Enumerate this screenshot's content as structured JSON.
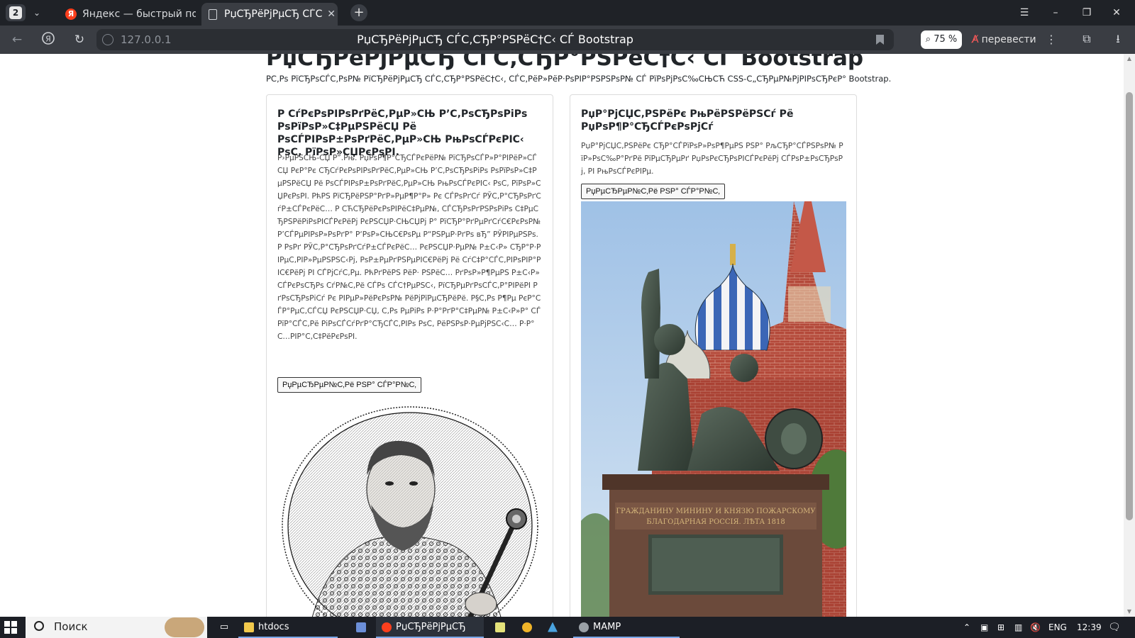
{
  "browser": {
    "tab_count": "2",
    "tabs": [
      {
        "title": "Яндекс — быстрый поиск",
        "favicon": "yandex-icon"
      },
      {
        "title": "РџСЂРёРјРµСЂ СЃС‚СЂР°РЅРёС†С‹ СЃ Bootstrap",
        "favicon": "document-icon",
        "close": "✕"
      }
    ],
    "new_tab": "+",
    "address": "127.0.0.1",
    "page_title": "РџСЂРёРјРµСЂ СЃС‚СЂР°РЅРёС†С‹ СЃ Bootstrap",
    "zoom": "75 %",
    "translate_label": "перевести"
  },
  "page": {
    "title": "РџСЂРёРјРµСЂ СЃС‚СЂР°РЅРёС†С‹ СЃ Bootstrap",
    "lead": "РС‚Рѕ РїСЂРѕСЃС‚РѕР№ РїСЂРёРјРµСЂ СЃС‚СЂР°РЅРёС†С‹, СЃС‚РёР»РёР·РѕРІР°РЅРЅРѕР№ СЃ РїРѕРјРѕС‰СЊСЋ CSS-С„СЂРµР№РјРІРѕСЂРєР° Bootstrap.",
    "cards": [
      {
        "title": "Р СѓРєРѕРІРѕРґРёС‚РµР»СЊ Р’С‚РѕСЂРѕРіРѕ РѕРїРѕР»С‡РµРЅРёСЏ Рё РѕСЃРІРѕР±РѕРґРёС‚РµР»СЊ РњРѕСЃРєРІС‹ РѕС‚ РїРѕР»СЏРєРѕРІ.",
        "text": "Р›РµРЅСЊ-СЏ Р”.Рњ. РџРѕР¶Р°СЂСЃРєРёР№ РїСЂРѕСЃР»Р°РІРёР»СЃСЏ РєР°Рє СЂСѓРєРѕРІРѕРґРёС‚РµР»СЊ Р’С‚РѕСЂРѕРіРѕ РѕРїРѕР»С‡РµРЅРёСЏ Рё РѕСЃРІРѕР±РѕРґРёС‚РµР»СЊ РњРѕСЃРєРІС‹ РѕС‚ РїРѕР»СЏРєРѕРІ. РћРЅ РїСЂРёРЅР°РґР»РµР¶Р°Р» Рє СЃРѕРґСѓ РЎС‚Р°СЂРѕРґСѓР±СЃРєРёС… Р СЋСЂРёРєРѕРІРёС‡РµР№, СЃСЂРѕРґРЅРѕРіРѕ С‡РµСЂРЅРёРіРѕРІСЃРєРёРј РєРЅСЏР·СЊСЏРј Р° РїСЂР°РґРµРґСѓС€РєРѕР№ Р’СЃРµРІРѕР»РѕРґР° Р‘РѕР»СЊС€РѕРµ Р“РЅРµР·РґРѕ вЂ” РЎРІРµРЅРѕ. Р РѕРґ РЎС‚Р°СЂРѕРґСѓР±СЃРєРёС… РєРЅСЏР·РµР№ Р±С‹Р» СЂР°Р·РІРµС‚РІР»РµРЅРЅС‹Рј, РѕР±РµРґРЅРµРІС€РёРј Рё СѓС‡Р°СЃС‚РІРѕРІР°РІС€РёРј РІ СЃРјСѓС‚Рµ. РћРґРёРЅ РёР· РЅРёС… РґРѕР»Р¶РµРЅ Р±С‹Р» СЃРєРѕСЂРѕ СѓР№С‚Рё СЃРѕ СЃС†РµРЅС‹, РїСЂРµРґРѕСЃС‚Р°РІРёРІ РґРѕСЂРѕРіСѓ Рє РІРµР»РёРєРѕР№ РёРјРїРµСЂРёРё. Р§С‚Рѕ Р¶Рµ РєР°СЃР°РµС‚СЃСЏ РєРЅСЏР·СЏ, С‚Рѕ РµРіРѕ Р·Р°РґР°С‡РµР№ Р±С‹Р»Р° СЃРїР°СЃС‚Рё РіРѕСЃСѓРґР°СЂСЃС‚РІРѕ РѕС‚ РёРЅРѕР·РµРјРЅС‹С… Р·Р°С…РІР°С‚С‡РёРєРѕРІ.",
        "button": "РџРµСЂРµР№С‚Рё РЅР° СЃР°Р№С‚"
      },
      {
        "title": "РџР°РјСЏС‚РЅРёРє РњРёРЅРёРЅСѓ Рё РџРѕР¶Р°СЂСЃРєРѕРјСѓ",
        "text": "РџР°РјСЏС‚РЅРёРє СЂР°СЃРїРѕР»РѕР¶РµРЅ РЅР° РљСЂР°СЃРЅРѕР№ РїР»РѕС‰Р°РґРё РїРµСЂРµРґ РџРѕРєСЂРѕРІСЃРєРёРј СЃРѕР±РѕСЂРѕРј, РІ РњРѕСЃРєРІРµ.",
        "button": "РџРµСЂРµР№С‚Рё РЅР° СЃР°Р№С‚"
      }
    ],
    "monument_inscription_1": "ГРАЖДАНИНУ МИНИНУ И КНЯЗЮ ПОЖАРСКОМУ",
    "monument_inscription_2": "БЛАГОДАРНАЯ РОССІЯ. ЛѢТА 1818"
  },
  "taskbar": {
    "search_label": "Поиск",
    "items": [
      {
        "label": "htdocs",
        "icon": "folder-icon"
      },
      {
        "label": "РџСЂРёРјРµСЂ СЃС‚...",
        "icon": "yandex-browser-icon"
      },
      {
        "label": "MAMP",
        "icon": "mamp-icon"
      }
    ],
    "lang": "ENG",
    "time": "12:39"
  },
  "colors": {
    "tabbar_bg": "#1f2227",
    "addrbar_bg": "#3a3d43",
    "taskbar_bg": "#1c1f26",
    "yandex_red": "#fc3f1d"
  }
}
